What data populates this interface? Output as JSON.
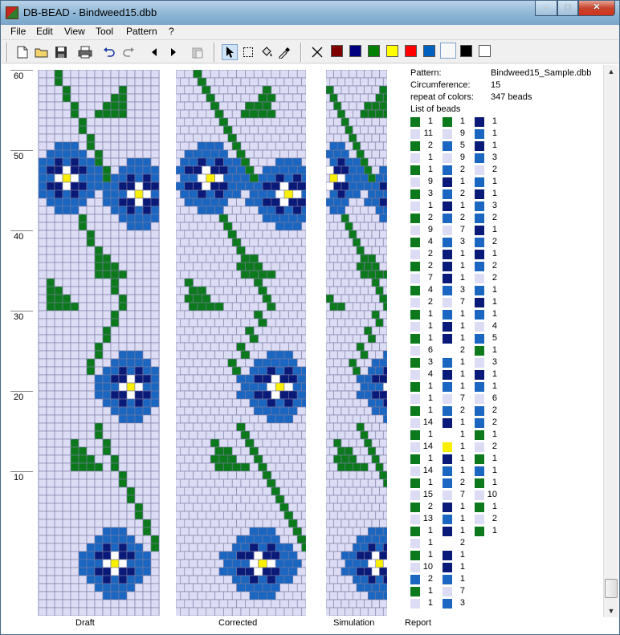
{
  "window": {
    "title": "DB-BEAD - Bindweed15.dbb"
  },
  "menu": [
    "File",
    "Edit",
    "View",
    "Tool",
    "Pattern",
    "?"
  ],
  "toolbar": {
    "tools": [
      "new-icon",
      "open-icon",
      "save-icon",
      "print-icon",
      "undo-icon",
      "redo-icon",
      "arrow-left-icon",
      "arrow-right-icon",
      "paste-icon",
      "pointer-icon",
      "select-rect-icon",
      "fill-icon",
      "eyedropper-icon",
      "delete-icon"
    ],
    "palette": [
      "#800000",
      "#000080",
      "#008000",
      "#ffff00",
      "#ff0000",
      "#0060c0",
      "#f8f8f8",
      "#000000",
      "#ffffff"
    ]
  },
  "ruler": {
    "labels": [
      "60",
      "50",
      "40",
      "30",
      "20",
      "10"
    ]
  },
  "panels": {
    "draft": "Draft",
    "corrected": "Corrected",
    "simulation": "Simulation",
    "report": "Report"
  },
  "report": {
    "pattern_label": "Pattern:",
    "pattern_value": "Bindweed15_Sample.dbb",
    "circ_label": "Circumference:",
    "circ_value": "15",
    "repeat_label": "repeat of colors:",
    "repeat_value": "347 beads",
    "list_label": "List of beads"
  },
  "colors": {
    "bg": "#dcdcf5",
    "green": "#0c7a1c",
    "navy": "#0a1a78",
    "blue": "#1a66c0",
    "yellow": "#f8f000",
    "white": "#ffffff"
  },
  "bead_columns": [
    [
      [
        "g",
        "1"
      ],
      [
        "l",
        "11"
      ],
      [
        "g",
        "2"
      ],
      [
        "l",
        "1"
      ],
      [
        "g",
        "1"
      ],
      [
        "l",
        "9"
      ],
      [
        "g",
        "3"
      ],
      [
        "l",
        "1"
      ],
      [
        "g",
        "2"
      ],
      [
        "l",
        "9"
      ],
      [
        "g",
        "4"
      ],
      [
        "l",
        "2"
      ],
      [
        "g",
        "2"
      ],
      [
        "l",
        "7"
      ],
      [
        "g",
        "4"
      ],
      [
        "l",
        "2"
      ],
      [
        "g",
        "1"
      ],
      [
        "l",
        "1"
      ],
      [
        "g",
        "1"
      ],
      [
        "l",
        "6"
      ],
      [
        "g",
        "3"
      ],
      [
        "l",
        "4"
      ],
      [
        "g",
        "1"
      ],
      [
        "l",
        "1"
      ],
      [
        "g",
        "1"
      ],
      [
        "l",
        "14"
      ],
      [
        "g",
        "1"
      ],
      [
        "l",
        "14"
      ],
      [
        "g",
        "1"
      ],
      [
        "l",
        "14"
      ],
      [
        "g",
        "1"
      ],
      [
        "l",
        "15"
      ],
      [
        "g",
        "2"
      ],
      [
        "l",
        "13"
      ],
      [
        "g",
        "1"
      ],
      [
        "l",
        "1"
      ],
      [
        "g",
        "1"
      ],
      [
        "l",
        "10"
      ],
      [
        "b",
        "2"
      ],
      [
        "g",
        "1"
      ],
      [
        "l",
        "1"
      ]
    ],
    [
      [
        "g",
        "1"
      ],
      [
        "l",
        "9"
      ],
      [
        "b",
        "5"
      ],
      [
        "l",
        "9"
      ],
      [
        "b",
        "2"
      ],
      [
        "n",
        "1"
      ],
      [
        "b",
        "2"
      ],
      [
        "n",
        "1"
      ],
      [
        "b",
        "2"
      ],
      [
        "l",
        "7"
      ],
      [
        "b",
        "3"
      ],
      [
        "n",
        "1"
      ],
      [
        "n",
        "1"
      ],
      [
        "n",
        "1"
      ],
      [
        "b",
        "3"
      ],
      [
        "l",
        "7"
      ],
      [
        "b",
        "1"
      ],
      [
        "n",
        "1"
      ],
      [
        "n",
        "1"
      ],
      [
        "w",
        "2"
      ],
      [
        "b",
        "1"
      ],
      [
        "n",
        "1"
      ],
      [
        "b",
        "1"
      ],
      [
        "l",
        "7"
      ],
      [
        "b",
        "2"
      ],
      [
        "n",
        "1"
      ],
      [
        "w",
        "1"
      ],
      [
        "y",
        "1"
      ],
      [
        "n",
        "1"
      ],
      [
        "b",
        "1"
      ],
      [
        "b",
        "2"
      ],
      [
        "l",
        "7"
      ],
      [
        "n",
        "1"
      ],
      [
        "b",
        "1"
      ],
      [
        "n",
        "1"
      ],
      [
        "w",
        "2"
      ],
      [
        "n",
        "1"
      ],
      [
        "n",
        "1"
      ],
      [
        "b",
        "1"
      ],
      [
        "l",
        "7"
      ],
      [
        "b",
        "3"
      ]
    ],
    [
      [
        "n",
        "1"
      ],
      [
        "b",
        "1"
      ],
      [
        "n",
        "1"
      ],
      [
        "b",
        "3"
      ],
      [
        "l",
        "2"
      ],
      [
        "b",
        "1"
      ],
      [
        "n",
        "1"
      ],
      [
        "b",
        "3"
      ],
      [
        "b",
        "2"
      ],
      [
        "n",
        "1"
      ],
      [
        "b",
        "2"
      ],
      [
        "n",
        "1"
      ],
      [
        "b",
        "2"
      ],
      [
        "l",
        "2"
      ],
      [
        "b",
        "1"
      ],
      [
        "n",
        "1"
      ],
      [
        "b",
        "1"
      ],
      [
        "l",
        "4"
      ],
      [
        "b",
        "5"
      ],
      [
        "g",
        "1"
      ],
      [
        "l",
        "3"
      ],
      [
        "n",
        "1"
      ],
      [
        "b",
        "1"
      ],
      [
        "l",
        "6"
      ],
      [
        "b",
        "2"
      ],
      [
        "b",
        "2"
      ],
      [
        "g",
        "1"
      ],
      [
        "l",
        "2"
      ],
      [
        "g",
        "1"
      ],
      [
        "b",
        "1"
      ],
      [
        "g",
        "1"
      ],
      [
        "l",
        "10"
      ],
      [
        "g",
        "1"
      ],
      [
        "l",
        "2"
      ],
      [
        "g",
        "1"
      ]
    ]
  ]
}
